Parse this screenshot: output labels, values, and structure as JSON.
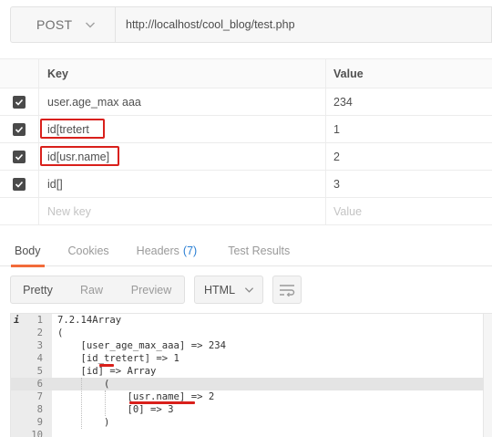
{
  "request": {
    "method": "POST",
    "url": "http://localhost/cool_blog/test.php"
  },
  "params": {
    "headers": {
      "key": "Key",
      "value": "Value"
    },
    "rows": [
      {
        "checked": true,
        "key": "user.age_max aaa",
        "value": "234"
      },
      {
        "checked": true,
        "key": "id[tretert",
        "value": "1"
      },
      {
        "checked": true,
        "key": "id[usr.name]",
        "value": "2"
      },
      {
        "checked": true,
        "key": "id[]",
        "value": "3"
      }
    ],
    "new_row": {
      "key_placeholder": "New key",
      "value_placeholder": "Value"
    }
  },
  "response_tabs": {
    "body": "Body",
    "cookies": "Cookies",
    "headers": "Headers",
    "headers_count": "(7)",
    "test_results": "Test Results"
  },
  "toolbar": {
    "pretty": "Pretty",
    "raw": "Raw",
    "preview": "Preview",
    "format": "HTML"
  },
  "code": {
    "lines": [
      {
        "n": "1",
        "text": "7.2.14Array"
      },
      {
        "n": "2",
        "text": "("
      },
      {
        "n": "3",
        "text": "    [user_age_max_aaa] => 234"
      },
      {
        "n": "4",
        "text": "    [id_tretert] => 1"
      },
      {
        "n": "5",
        "text": "    [id] => Array"
      },
      {
        "n": "6",
        "text": "        ("
      },
      {
        "n": "7",
        "text": "            [usr.name] => 2"
      },
      {
        "n": "8",
        "text": "            [0] => 3"
      },
      {
        "n": "9",
        "text": "        )"
      },
      {
        "n": "10",
        "text": ""
      }
    ]
  },
  "colors": {
    "accent": "#f26b3a",
    "highlight": "#d9201b",
    "link": "#2a7fd4"
  }
}
